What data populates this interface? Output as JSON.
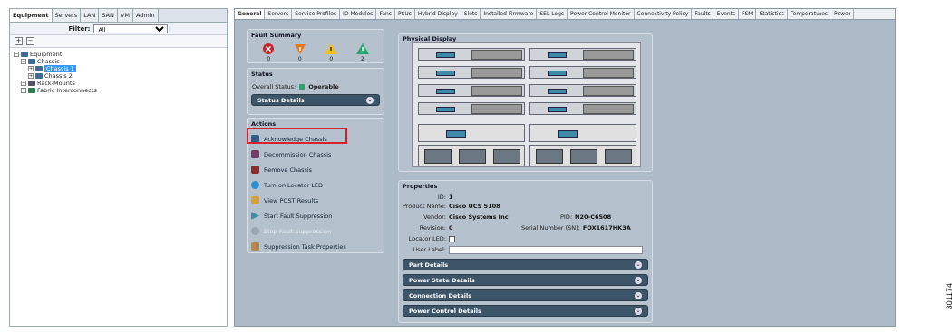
{
  "left_panel": {
    "tabs": [
      "Equipment",
      "Servers",
      "LAN",
      "SAN",
      "VM",
      "Admin"
    ],
    "filter_label": "Filter:",
    "filter_value": "All",
    "tool_expand": "+",
    "tool_collapse": "−",
    "tree": {
      "root": "Equipment",
      "chassis": "Chassis",
      "chassis1": "Chassis 1",
      "chassis2": "Chassis 2",
      "rack": "Rack-Mounts",
      "fabric": "Fabric Interconnects"
    }
  },
  "right_panel": {
    "tabs": [
      "General",
      "Servers",
      "Service Profiles",
      "IO Modules",
      "Fans",
      "PSUs",
      "Hybrid Display",
      "Slots",
      "Installed Firmware",
      "SEL Logs",
      "Power Control Monitor",
      "Connectivity Policy",
      "Faults",
      "Events",
      "FSM",
      "Statistics",
      "Temperatures",
      "Power"
    ],
    "fault_summary": {
      "title": "Fault Summary",
      "counts": [
        "0",
        "0",
        "0",
        "2"
      ],
      "colors": [
        "#c8262c",
        "#e8781e",
        "#f0c020",
        "#2aa36f"
      ]
    },
    "status": {
      "title": "Status",
      "overall_label": "Overall Status:",
      "overall_value": "Operable",
      "details": "Status Details"
    },
    "actions": {
      "title": "Actions",
      "items": [
        {
          "label": "Acknowledge Chassis",
          "icon": "chassis-icon"
        },
        {
          "label": "Decommission Chassis",
          "icon": "chassis-icon"
        },
        {
          "label": "Remove Chassis",
          "icon": "chassis-icon"
        },
        {
          "label": "Turn on Locator LED",
          "icon": "led-icon"
        },
        {
          "label": "View POST Results",
          "icon": "post-icon"
        },
        {
          "label": "Start Fault Suppression",
          "icon": "play-icon"
        },
        {
          "label": "Stop Fault Suppression",
          "icon": "stop-icon"
        },
        {
          "label": "Suppression Task Properties",
          "icon": "task-icon"
        }
      ]
    },
    "physical_display": {
      "title": "Physical Display"
    },
    "properties": {
      "title": "Properties",
      "id_label": "ID:",
      "id_value": "1",
      "product_label": "Product Name:",
      "product_value": "Cisco UCS 5108",
      "vendor_label": "Vendor:",
      "vendor_value": "Cisco Systems Inc",
      "pid_label": "PID:",
      "pid_value": "N20-C6508",
      "revision_label": "Revision:",
      "revision_value": "0",
      "serial_label": "Serial Number (SN):",
      "serial_value": "FOX1617HK3A",
      "locator_label": "Locator LED:",
      "user_label": "User Label:",
      "sections": [
        "Part Details",
        "Power State Details",
        "Connection Details",
        "Power Control Details"
      ]
    }
  },
  "figure_id": "301174"
}
